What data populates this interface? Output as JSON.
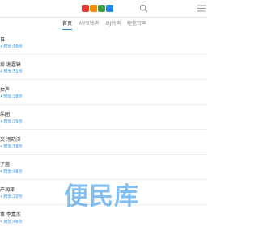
{
  "header": {
    "logo": {
      "letters": [
        "",
        "",
        "",
        ""
      ],
      "colors": [
        "#e53935",
        "#fb8c00",
        "#43a047",
        "#1e88e5"
      ],
      "suffix": ""
    },
    "search_icon": "search-icon",
    "menu_icon": "menu-icon"
  },
  "tabs": [
    {
      "label": "首页",
      "active": true
    },
    {
      "label": "MP3铃声",
      "active": false
    },
    {
      "label": "DJ铃声",
      "active": false
    },
    {
      "label": "短信铃声",
      "active": false
    }
  ],
  "items": [
    {
      "title": "日",
      "meta": "• 时长:56秒"
    },
    {
      "title": "爱 谢霆锋",
      "meta": "• 时长:51秒"
    },
    {
      "title": "女声",
      "meta": "• 时长:38秒"
    },
    {
      "title": "乐团",
      "meta": "• 时长:35秒"
    },
    {
      "title": "文 汤晓泽",
      "meta": "• 时长:59秒"
    },
    {
      "title": "了茵",
      "meta": "• 时长:46秒"
    },
    {
      "title": "产润泽",
      "meta": "• 时长:20秒"
    },
    {
      "title": "事 李嘉杰",
      "meta": "• 时长:46秒"
    }
  ],
  "watermark": "便民库",
  "colors": {
    "accent": "#1e88e5"
  }
}
